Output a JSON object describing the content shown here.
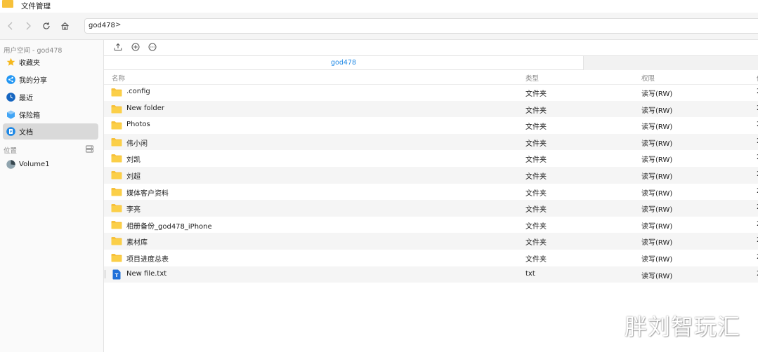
{
  "app": {
    "title": "文件管理"
  },
  "path": {
    "segment": "god478",
    "chevron": ">"
  },
  "sidebar": {
    "user_section": "用户空间 - god478",
    "items": [
      {
        "label": "收藏夹",
        "icon": "star-icon"
      },
      {
        "label": "我的分享",
        "icon": "share-icon"
      },
      {
        "label": "最近",
        "icon": "clock-icon"
      },
      {
        "label": "保险箱",
        "icon": "vault-icon"
      },
      {
        "label": "文档",
        "icon": "document-icon",
        "active": true
      }
    ],
    "location_section": "位置",
    "volumes": [
      {
        "label": "Volume1",
        "icon": "disk-icon"
      }
    ]
  },
  "tabs": [
    {
      "label": "god478",
      "active": true
    }
  ],
  "table": {
    "columns": {
      "name": "名称",
      "type": "类型",
      "perm": "权限",
      "extra": "修"
    },
    "rows": [
      {
        "name": ".config",
        "type": "文件夹",
        "perm": "读写(RW)",
        "extra": "2",
        "icon": "folder-icon"
      },
      {
        "name": "New folder",
        "type": "文件夹",
        "perm": "读写(RW)",
        "extra": "2",
        "icon": "folder-icon"
      },
      {
        "name": "Photos",
        "type": "文件夹",
        "perm": "读写(RW)",
        "extra": "2",
        "icon": "folder-icon"
      },
      {
        "name": "伟小闲",
        "type": "文件夹",
        "perm": "读写(RW)",
        "extra": "2",
        "icon": "folder-icon"
      },
      {
        "name": "刘凯",
        "type": "文件夹",
        "perm": "读写(RW)",
        "extra": "2",
        "icon": "folder-icon"
      },
      {
        "name": "刘超",
        "type": "文件夹",
        "perm": "读写(RW)",
        "extra": "2",
        "icon": "folder-icon"
      },
      {
        "name": "媒体客户资料",
        "type": "文件夹",
        "perm": "读写(RW)",
        "extra": "2",
        "icon": "folder-icon"
      },
      {
        "name": "李亮",
        "type": "文件夹",
        "perm": "读写(RW)",
        "extra": "2",
        "icon": "folder-icon"
      },
      {
        "name": "相册备份_god478_iPhone",
        "type": "文件夹",
        "perm": "读写(RW)",
        "extra": "2",
        "icon": "folder-icon"
      },
      {
        "name": "素材库",
        "type": "文件夹",
        "perm": "读写(RW)",
        "extra": "2",
        "icon": "folder-icon"
      },
      {
        "name": "项目进度总表",
        "type": "文件夹",
        "perm": "读写(RW)",
        "extra": "2",
        "icon": "folder-icon"
      },
      {
        "name": "New file.txt",
        "type": "txt",
        "perm": "读写(RW)",
        "extra": "2",
        "icon": "text-file-icon"
      }
    ]
  },
  "watermark": "胖刘智玩汇",
  "colors": {
    "accent": "#1e88e5",
    "folder": "#f7c13a",
    "active_bg": "#d9d9d9"
  }
}
